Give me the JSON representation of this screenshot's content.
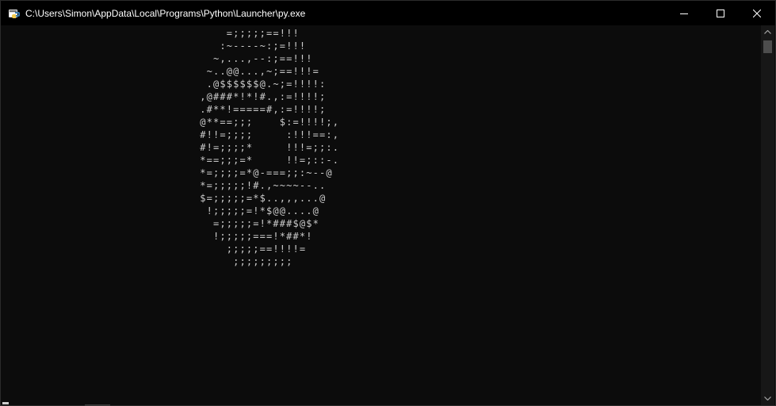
{
  "window": {
    "title": "C:\\Users\\Simon\\AppData\\Local\\Programs\\Python\\Launcher\\py.exe",
    "icon": "python-launcher-icon"
  },
  "controls": {
    "minimize": "minimize-icon",
    "maximize": "maximize-icon",
    "close": "close-icon"
  },
  "console": {
    "output": "                                  =;;;;;==!!!\n                                 :~----~:;=!!!\n                                ~,...,--:;==!!!\n                               ~..@@...,~;==!!!=\n                               .@$$$$$$@.~;=!!!!:\n                              ,@###*!*!#.,:=!!!!;\n                              .#**!=====#,:=!!!!;\n                              @**==;;;    $:=!!!!;,\n                              #!!=;;;;     :!!!==:,\n                              #!=;;;;*     !!!=;;:.\n                              *==;;;=*     !!=;::-.\n                              *=;;;;=*@-===;;:~--@\n                              *=;;;;;!#.,~~~~--..\n                              $=;;;;;=*$..,,,...@\n                               !;;;;;=!*$@@....@\n                                =;;;;;=!*###$@$*\n                                !;;;;;===!*##*!\n                                  ;;;;;==!!!!=\n                                   ;;;;;;;;;"
  },
  "scrollbar": {
    "up": "scroll-up-arrow-icon",
    "down": "scroll-down-arrow-icon"
  },
  "colors": {
    "background": "#0c0c0c",
    "text": "#cccccc",
    "titlebar": "#000000"
  }
}
